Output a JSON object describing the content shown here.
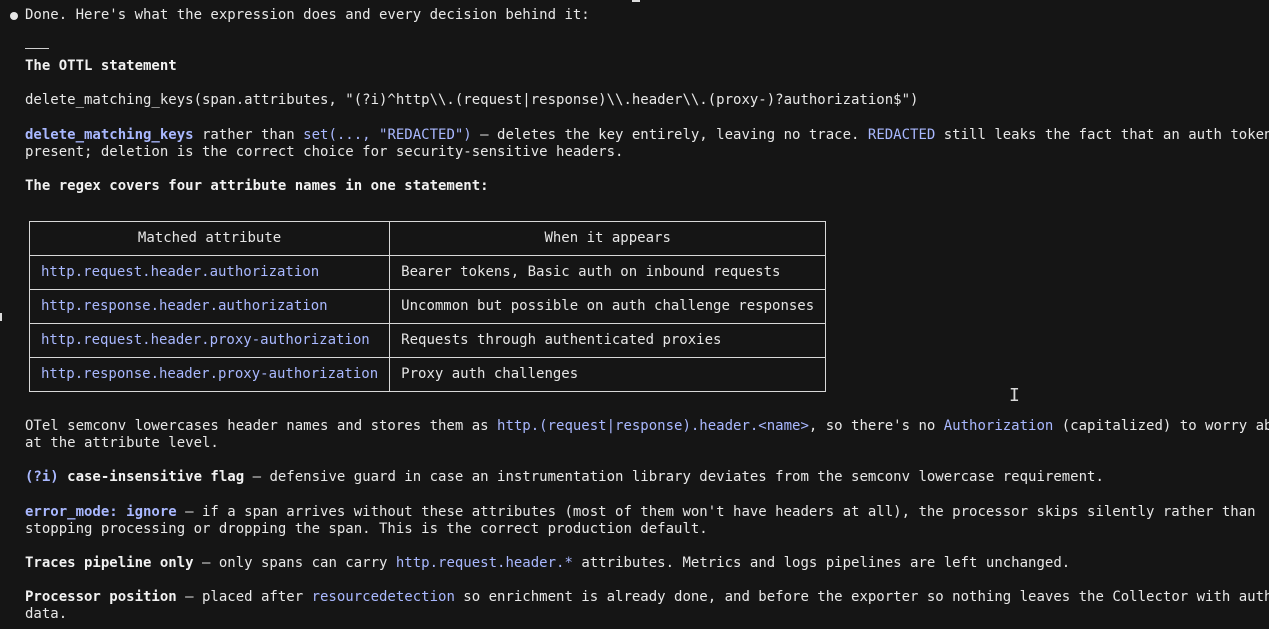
{
  "intro": "Done. Here's what the expression does and every decision behind it:",
  "section_title": "The OTTL statement",
  "statement": "delete_matching_keys(span.attributes, \"(?i)^http\\\\.(request|response)\\\\.header\\\\.(proxy-)?authorization$\")",
  "para1": {
    "code1": "delete_matching_keys",
    "t1": " rather than ",
    "code2": "set(..., \"REDACTED\")",
    "t2": " — deletes the key entirely, leaving no trace. ",
    "code3": "REDACTED",
    "t3": " still leaks the fact that an auth token was",
    "line2": "present; deletion is the correct choice for security-sensitive headers."
  },
  "regex_heading": "The regex covers four attribute names in one statement:",
  "table": {
    "headers": [
      "Matched attribute",
      "When it appears"
    ],
    "rows": [
      [
        "http.request.header.authorization",
        "Bearer tokens, Basic auth on inbound requests"
      ],
      [
        "http.response.header.authorization",
        "Uncommon but possible on auth challenge responses"
      ],
      [
        "http.request.header.proxy-authorization",
        "Requests through authenticated proxies"
      ],
      [
        "http.response.header.proxy-authorization",
        "Proxy auth challenges"
      ]
    ]
  },
  "para2": {
    "t1": "OTel semconv lowercases header names and stores them as ",
    "code1": "http.(request|response).header.<name>",
    "t2": ", so there's no ",
    "code2": "Authorization",
    "t3": " (capitalized) to worry about",
    "line2": "at the attribute level."
  },
  "para3": {
    "code1": "(?i)",
    "b1": " case-insensitive flag",
    "t1": " — defensive guard in case an instrumentation library deviates from the semconv lowercase requirement."
  },
  "para4": {
    "code1": "error_mode: ignore",
    "t1": " — if a span arrives without these attributes (most of them won't have headers at all), the processor skips silently rather than",
    "line2": "stopping processing or dropping the span. This is the correct production default."
  },
  "para5": {
    "b1": "Traces pipeline only",
    "t1": " — only spans can carry ",
    "code1": "http.request.header.*",
    "t2": " attributes. Metrics and logs pipelines are left unchanged."
  },
  "para6": {
    "b1": "Processor position",
    "t1": " — placed after ",
    "code1": "resourcedetection",
    "t2": " so enrichment is already done, and before the exporter so nothing leaves the Collector with auth",
    "line2": "data."
  }
}
